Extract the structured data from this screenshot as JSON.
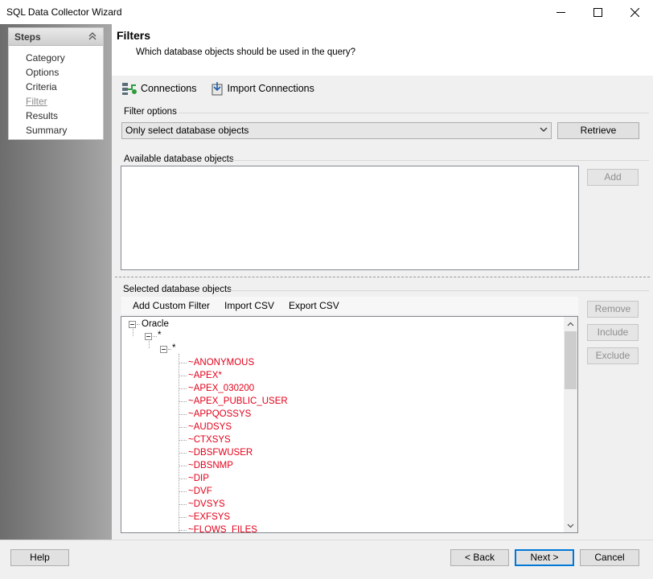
{
  "window": {
    "title": "SQL Data Collector Wizard"
  },
  "sidebar": {
    "header": "Steps",
    "items": [
      {
        "label": "Category",
        "current": false
      },
      {
        "label": "Options",
        "current": false
      },
      {
        "label": "Criteria",
        "current": false
      },
      {
        "label": "Filter",
        "current": true
      },
      {
        "label": "Results",
        "current": false
      },
      {
        "label": "Summary",
        "current": false
      }
    ]
  },
  "header": {
    "title": "Filters",
    "subtitle": "Which database objects should be used in the query?"
  },
  "toolbar": {
    "connections": "Connections",
    "import_connections": "Import Connections"
  },
  "filter_options": {
    "label": "Filter options",
    "selected": "Only select database objects",
    "retrieve": "Retrieve"
  },
  "available": {
    "label": "Available database objects",
    "add": "Add"
  },
  "selected": {
    "label": "Selected database objects",
    "add_custom_filter": "Add Custom Filter",
    "import_csv": "Import CSV",
    "export_csv": "Export CSV",
    "remove": "Remove",
    "include": "Include",
    "exclude": "Exclude",
    "tree": {
      "root": "Oracle",
      "level1": "*",
      "level2": "*",
      "leaves": [
        "~ANONYMOUS",
        "~APEX*",
        "~APEX_030200",
        "~APEX_PUBLIC_USER",
        "~APPQOSSYS",
        "~AUDSYS",
        "~CTXSYS",
        "~DBSFWUSER",
        "~DBSNMP",
        "~DIP",
        "~DVF",
        "~DVSYS",
        "~EXFSYS",
        "~FLOWS_FILES"
      ]
    }
  },
  "footer": {
    "help": "Help",
    "back": "< Back",
    "next": "Next >",
    "cancel": "Cancel"
  }
}
